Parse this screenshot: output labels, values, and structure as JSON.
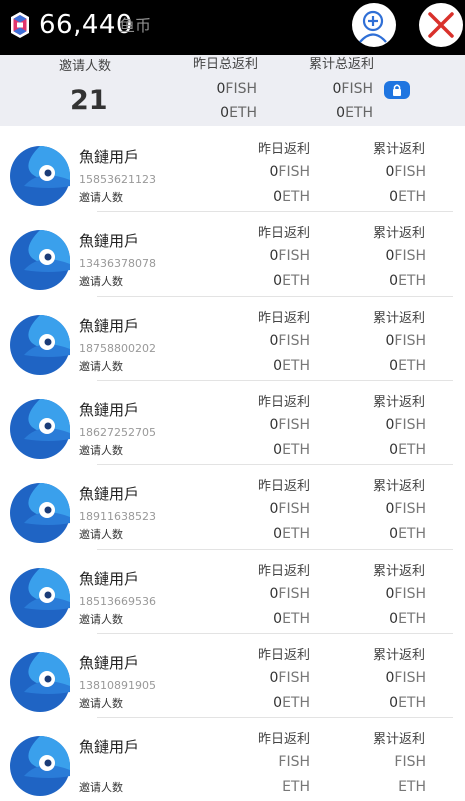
{
  "header": {
    "balance": "66,440",
    "unit": "鱼币",
    "icons": {
      "coin": "coin-icon",
      "add": "add-user-icon",
      "close": "close-icon"
    },
    "colors": {
      "bar": "#000000",
      "close": "#d9312b",
      "accent": "#1f75e0"
    }
  },
  "summary": {
    "invite_label": "邀请人数",
    "invite_count": "21",
    "yesterday_label": "昨日总返利",
    "yesterday_fish": "0",
    "yesterday_fish_unit": "FISH",
    "yesterday_eth": "0",
    "yesterday_eth_unit": "ETH",
    "total_label": "累计总返利",
    "total_fish": "0",
    "total_fish_unit": "FISH",
    "total_eth": "0",
    "total_eth_unit": "ETH",
    "lock_icon": "lock-icon"
  },
  "list": {
    "yesterday_label": "昨日返利",
    "total_label": "累计返利",
    "invite_label": "邀请人数",
    "fish_unit": "FISH",
    "eth_unit": "ETH",
    "avatar_icon": "fish-avatar-icon",
    "items": [
      {
        "name": "魚鏈用戶",
        "phone": "15853621123",
        "y_fish": "0",
        "y_eth": "0",
        "t_fish": "0",
        "t_eth": "0"
      },
      {
        "name": "魚鏈用戶",
        "phone": "13436378078",
        "y_fish": "0",
        "y_eth": "0",
        "t_fish": "0",
        "t_eth": "0"
      },
      {
        "name": "魚鏈用戶",
        "phone": "18758800202",
        "y_fish": "0",
        "y_eth": "0",
        "t_fish": "0",
        "t_eth": "0"
      },
      {
        "name": "魚鏈用戶",
        "phone": "18627252705",
        "y_fish": "0",
        "y_eth": "0",
        "t_fish": "0",
        "t_eth": "0"
      },
      {
        "name": "魚鏈用戶",
        "phone": "18911638523",
        "y_fish": "0",
        "y_eth": "0",
        "t_fish": "0",
        "t_eth": "0"
      },
      {
        "name": "魚鏈用戶",
        "phone": "18513669536",
        "y_fish": "0",
        "y_eth": "0",
        "t_fish": "0",
        "t_eth": "0"
      },
      {
        "name": "魚鏈用戶",
        "phone": "13810891905",
        "y_fish": "0",
        "y_eth": "0",
        "t_fish": "0",
        "t_eth": "0"
      },
      {
        "name": "魚鏈用戶",
        "phone": "",
        "y_fish": "",
        "y_eth": "",
        "t_fish": "",
        "t_eth": ""
      }
    ]
  }
}
